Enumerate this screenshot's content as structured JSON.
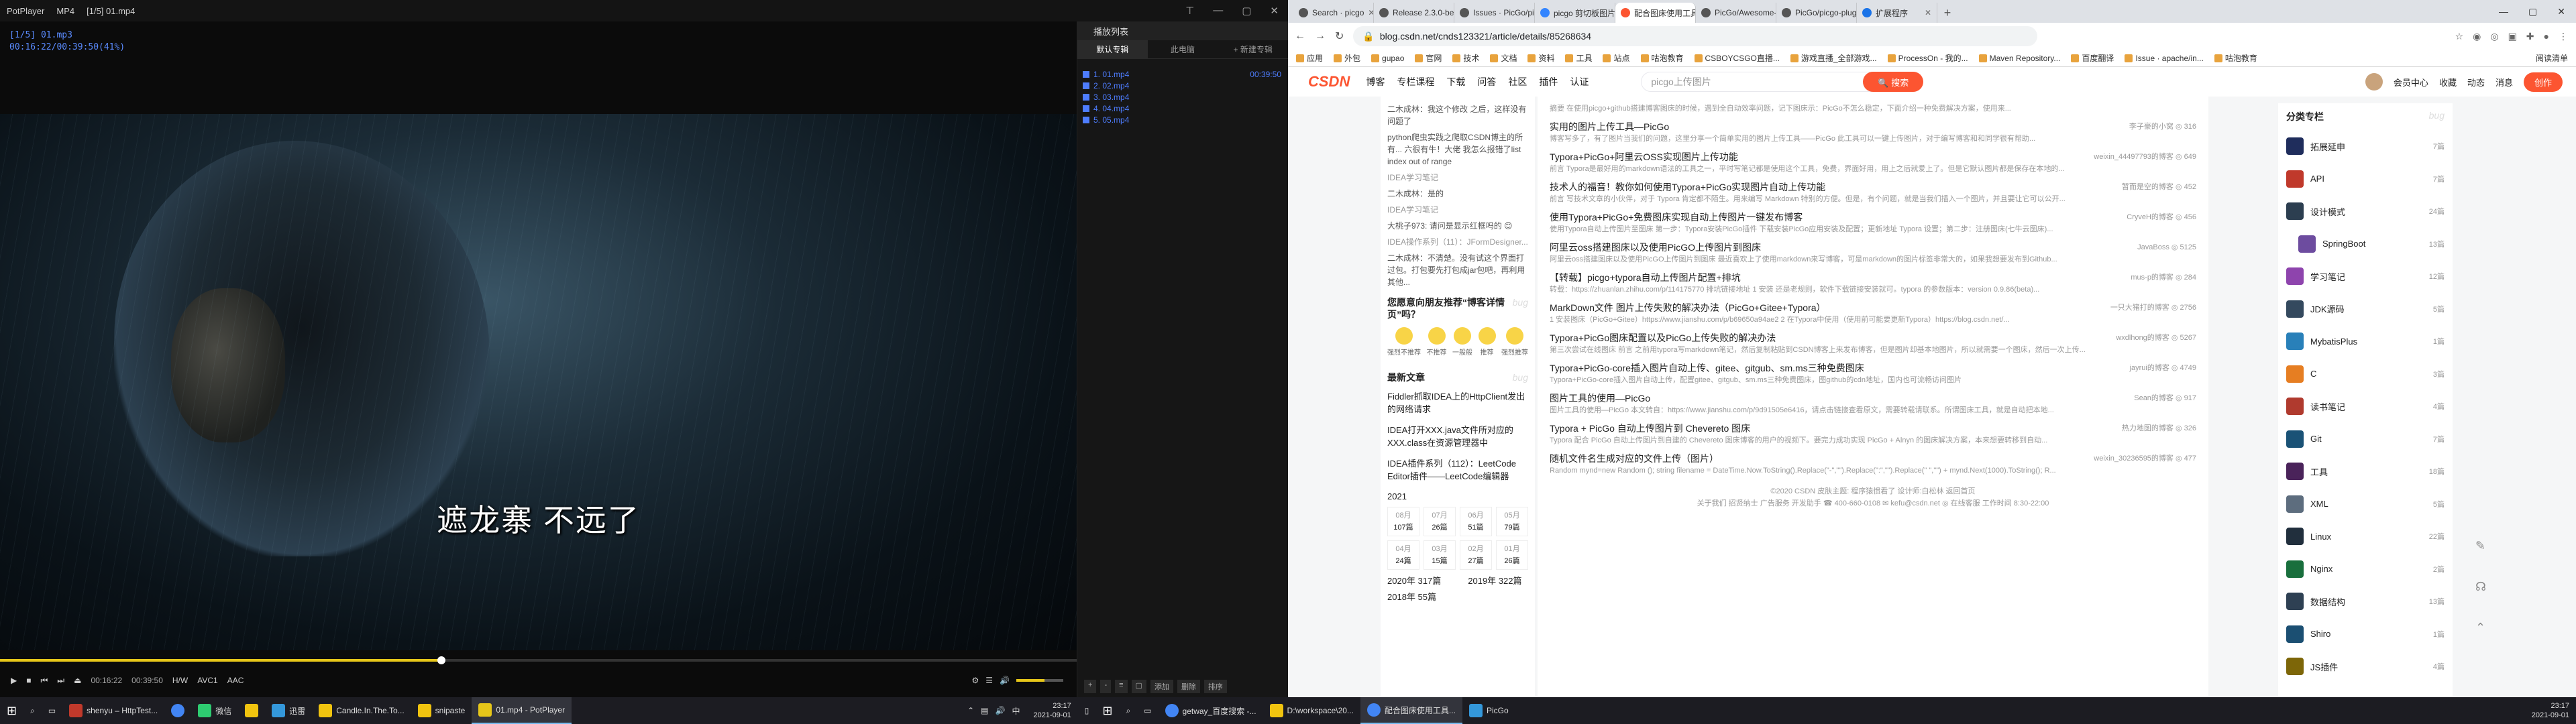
{
  "potplayer": {
    "app_name": "PotPlayer",
    "format": "MP4",
    "file_title": "[1/5] 01.mp4",
    "osd_file": "[1/5] 01.mp3",
    "osd_time": "00:16:22/00:39:50(41%)",
    "subtitle": "遮龙寨 不远了",
    "progress": 0.41,
    "time_current": "00:16:22",
    "time_total": "00:39:50",
    "ctrl_labels": [
      "H/W",
      "AVC1",
      "AAC"
    ],
    "playlist": {
      "header": "播放列表",
      "tabs": [
        "默认专辑",
        "此电脑",
        "+ 新建专辑"
      ],
      "items": [
        {
          "name": "1. 01.mp4",
          "duration": "00:39:50"
        },
        {
          "name": "2. 02.mp4",
          "duration": ""
        },
        {
          "name": "3. 03.mp4",
          "duration": ""
        },
        {
          "name": "4. 04.mp4",
          "duration": ""
        },
        {
          "name": "5. 05.mp4",
          "duration": ""
        }
      ],
      "bottom_buttons": [
        "+",
        "-",
        "≡",
        "▢",
        "添加",
        "删除",
        "排序"
      ]
    }
  },
  "chrome": {
    "tabs": [
      {
        "title": "Search · picgo"
      },
      {
        "title": "Release 2.3.0-beta.7 · Molunerfinn/PicGo"
      },
      {
        "title": "Issues · PicGo/picgo-plugin..."
      },
      {
        "title": "picgo 剪切板图片上传_百度..."
      },
      {
        "title": "配合图床使用工具: PicGo..."
      },
      {
        "title": "PicGo/Awesome-PicGo..."
      },
      {
        "title": "PicGo/picgo-plugin-qiniu..."
      },
      {
        "title": "扩展程序"
      }
    ],
    "url": "blog.csdn.net/cnds123321/article/details/85268634",
    "bookmarks": [
      "应用",
      "外包",
      "gupao",
      "官网",
      "技术",
      "文档",
      "资料",
      "工具",
      "站点",
      "咕泡教育",
      "CSBOYCSGO直播...",
      "游戏直播_全部游戏...",
      "ProcessOn - 我的...",
      "Maven Repository...",
      "百度翻译",
      "Issue · apache/in...",
      "咕泡教育"
    ],
    "bookmarks_right": "阅读清单"
  },
  "csdn": {
    "logo": "CSDN",
    "nav": [
      "博客",
      "专栏课程",
      "下载",
      "问答",
      "社区",
      "插件",
      "认证"
    ],
    "search_placeholder": "picgo上传图片",
    "search_button": "搜索",
    "right": [
      "会员中心",
      "收藏",
      "动态",
      "消息"
    ],
    "create_button": "创作",
    "left_comments": [
      "二木成林：我这个修改 之后，这样没有问题了",
      "python爬虫实践之爬取CSDN博主的所有... 六很有牛！大佬 我怎么报错了list index out of range",
      "IDEA学习笔记",
      "二木成林：是的",
      "IDEA学习笔记",
      "大桃子973: 请问是显示红框吗的 😊",
      "IDEA操作系列（11）：JFormDesigner...",
      "二木成林：不清楚。没有试这个界面打过包。打包要先打包成jar包吧，再利用其他..."
    ],
    "feedback_title": "您愿意向朋友推荐“博客详情页”吗？",
    "feedback_options": [
      "强烈不推荐",
      "不推荐",
      "一般般",
      "推荐",
      "强烈推荐"
    ],
    "recent_title": "最新文章",
    "recent": [
      "Fiddler抓取IDEA上的HttpClient发出的网络请求",
      "IDEA打开XXX.java文件所对应的XXX.class在资源管理器中",
      "IDEA插件系列（112）：LeetCode Editor插件——LeetCode编辑器"
    ],
    "archive_year": "2021",
    "archive": [
      {
        "m": "08月",
        "c": "107篇"
      },
      {
        "m": "07月",
        "c": "26篇"
      },
      {
        "m": "06月",
        "c": "51篇"
      },
      {
        "m": "05月",
        "c": "79篇"
      },
      {
        "m": "04月",
        "c": "24篇"
      },
      {
        "m": "03月",
        "c": "15篇"
      },
      {
        "m": "02月",
        "c": "27篇"
      },
      {
        "m": "01月",
        "c": "26篇"
      }
    ],
    "years": [
      {
        "y": "2020年",
        "c": "317篇"
      },
      {
        "y": "2019年",
        "c": "322篇"
      },
      {
        "y": "2018年",
        "c": "55篇"
      }
    ],
    "articles": [
      {
        "title": "...",
        "meta": "",
        "desc": "摘要 在使用picgo+github搭建博客图床的时候，遇到全自动效率问题，记下图床示：PicGo不怎么稳定，下面介绍一种免费解决方案，使用来..."
      },
      {
        "title": "实用的图片上传工具—PicGo",
        "meta": "李子豪的小窝 ◎ 316",
        "desc": "博客写多了，有了图片当我们的问题，这里分享一个简单实用的图片上传工具——PicGo 此工具可以一键上传图片，对于编写博客和和同学很有帮助..."
      },
      {
        "title": "Typora+PicGo+阿里云OSS实现图片上传功能",
        "meta": "weixin_44497793的博客 ◎ 649",
        "desc": "前言 Typora是最好用的markdown语法的工具之一，平时写笔记都是使用这个工具，免费，界面好用，用上之后就爱上了。但是它默认图片都是保存在本地的..."
      },
      {
        "title": "技术人的福音！教你如何使用Typora+PicGo实现图片自动上传功能",
        "meta": "暂而是空的博客 ◎ 452",
        "desc": "前言 写技术文章的小伙伴，对于 Typora 肯定都不陌生。用来编写 Markdown 特别的方便。但是，有个问题，就是当我们插入一个图片，并且要让它可以公开..."
      },
      {
        "title": "使用Typora+PicGo+免费图床实现自动上传图片一键发布博客",
        "meta": "CryveH的博客 ◎ 456",
        "desc": "使用Typora自动上传图片至图床 第一步：Typora安装PicGo插件 下载安装PicGo应用安装及配置；更新地址 Typora 设置；第二步：注册图床(七牛云图床)..."
      },
      {
        "title": "阿里云oss搭建图床以及使用PicGO上传图片到图床",
        "meta": "JavaBoss ◎ 5125",
        "desc": "阿里云oss搭建图床以及使用PicGO上传图片到图床 最近喜欢上了使用markdown来写博客，可是markdown的图片标签非常大的，如果我想要发布到Github..."
      },
      {
        "title": "【转载】picgo+typora自动上传图片配置+排坑",
        "meta": "mus-p的博客 ◎ 284",
        "desc": "转载：https://zhuanlan.zhihu.com/p/114175770 排坑链接地址 1 安装 还是老规则，软件下载链接安装就可。typora 的参数版本：version 0.9.86(beta)..."
      },
      {
        "title": "MarkDown文件 图片上传失败的解决办法（PicGo+Gitee+Typora）",
        "meta": "一只大猪打的博客 ◎ 2756",
        "desc": "1 安装图床（PicGo+Gitee）https://www.jianshu.com/p/b69650a94ae2 2 在Typora中使用（使用前可能要更新Typora）https://blog.csdn.net/..."
      },
      {
        "title": "Typora+PicGo图床配置以及PicGo上传失败的解决办法",
        "meta": "wxdlhong的博客 ◎ 5267",
        "desc": "第三次尝试在线图床 前言 之前用typora写markdown笔记，然后复制粘贴到CSDN博客上来发布博客，但是图片却基本地图片，所以就需要一个图床，然后一次上传..."
      },
      {
        "title": "Typora+PicGo-core插入图片自动上传、gitee、gitgub、sm.ms三种免费图床",
        "meta": "jayrui的博客 ◎ 4749",
        "desc": "Typora+PicGo-core插入图片自动上传，配置gitee、gitgub、sm.ms三种免费图床，图github的cdn地址，国内也可流畅访问图片"
      },
      {
        "title": "图片工具的使用—PicGo",
        "meta": "Sean的博客 ◎ 917",
        "desc": "图片工具的使用—PicGo 本文转自：https://www.jianshu.com/p/9d91505e6416，请点击链接查看原文，需要转载请联系。所谓图床工具，就是自动把本地..."
      },
      {
        "title": "Typora + PicGo 自动上传图片到 Chevereto 图床",
        "meta": "热力地图的博客 ◎ 326",
        "desc": "Typora 配合 PicGo 自动上传图片到自建的 Chevereto 图床博客的用户的视频下。要完力成功实现 PicGo + Alnyn 的图床解决方案，本来想要转移到自动..."
      },
      {
        "title": "随机文件名生成对应的文件上传（图片）",
        "meta": "weixin_30236595的博客 ◎ 477",
        "desc": "Random mynd=new Random (); string filename = DateTime.Now.ToString().Replace(\"-\",\"\").Replace(\":\",\"\").Replace(\" \",\"\") + mynd.Next(1000).ToString(); R..."
      }
    ],
    "footer": [
      "©2020 CSDN 皮肤主题: 程序猿惯看了 设计师:白松林 返回首页",
      "关于我们 招贤纳士 广告服务 开发助手 ☎ 400-660-0108 ✉ kefu@csdn.net ◎ 在线客服 工作时间 8:30-22:00"
    ],
    "columns_title": "分类专栏",
    "columns": [
      {
        "name": "拓展延申",
        "count": "7篇"
      },
      {
        "name": "API",
        "count": "7篇"
      },
      {
        "name": "设计模式",
        "count": "24篇"
      },
      {
        "name": "SpringBoot",
        "count": "13篇"
      },
      {
        "name": "学习笔记",
        "count": "12篇"
      },
      {
        "name": "JDK源码",
        "count": "5篇"
      },
      {
        "name": "MybatisPlus",
        "count": "1篇"
      },
      {
        "name": "C",
        "count": "3篇"
      },
      {
        "name": "读书笔记",
        "count": "4篇"
      },
      {
        "name": "Git",
        "count": "7篇"
      },
      {
        "name": "工具",
        "count": "18篇"
      },
      {
        "name": "XML",
        "count": "5篇"
      },
      {
        "name": "Linux",
        "count": "22篇"
      },
      {
        "name": "Nginx",
        "count": "2篇"
      },
      {
        "name": "数据结构",
        "count": "13篇"
      },
      {
        "name": "Shiro",
        "count": "1篇"
      },
      {
        "name": "JS插件",
        "count": "4篇"
      }
    ]
  },
  "taskbar": {
    "left_apps": [
      "shenyu – HttpTest...",
      "",
      "微信",
      "",
      "迅雷",
      "Candle.In.The.To...",
      "snipaste",
      "01.mp4 - PotPlayer"
    ],
    "left_clock": {
      "time": "23:17",
      "date": "2021-09-01"
    },
    "right_apps": [
      "getway_百度搜索 -...",
      "D:\\workspace\\20...",
      "配合图床使用工具...",
      "PicGo"
    ],
    "right_clock": {
      "time": "23:17",
      "date": "2021-09-01"
    }
  },
  "colors": {
    "accent": "#fc5531",
    "potplayer_blue": "#4e7dff",
    "seek": "#e6c619"
  }
}
